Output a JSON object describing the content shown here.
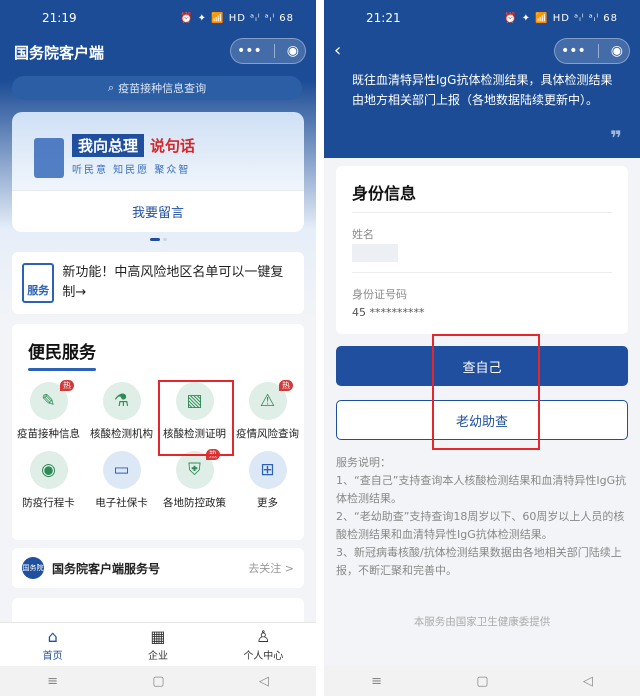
{
  "left": {
    "status": {
      "time": "21:19",
      "icons": "⏰ ✦ 📶 HD ᵃᵢˡ ᵃᵢˡ 68"
    },
    "app_title": "国务院客户端",
    "capsule": {
      "more": "•••",
      "close": "◉"
    },
    "search_placeholder": "疫苗接种信息查询",
    "banner": {
      "title_part1": "我向总理",
      "title_part2": "说句话",
      "subtitle": "听民意 知民愿 聚众智",
      "button": "我要留言"
    },
    "notice": {
      "icon_label": "服务",
      "text": "新功能！中高风险地区名单可以一键复制→"
    },
    "services": {
      "title": "便民服务",
      "items": [
        {
          "label": "疫苗接种信息",
          "icon": "clipboard-pen-icon",
          "glyph": "✎",
          "hot": "热"
        },
        {
          "label": "核酸检测机构",
          "icon": "test-tube-icon",
          "glyph": "⚗",
          "hot": ""
        },
        {
          "label": "核酸检测证明",
          "icon": "certificate-icon",
          "glyph": "▧",
          "hot": ""
        },
        {
          "label": "疫情风险查询",
          "icon": "warning-icon",
          "glyph": "⚠",
          "hot": "热"
        },
        {
          "label": "防疫行程卡",
          "icon": "location-pin-icon",
          "glyph": "◉",
          "hot": ""
        },
        {
          "label": "电子社保卡",
          "icon": "id-card-icon",
          "glyph": "▭",
          "hot": ""
        },
        {
          "label": "各地防控政策",
          "icon": "shield-doc-icon",
          "glyph": "⛨",
          "hot": "热"
        },
        {
          "label": "更多",
          "icon": "grid-more-icon",
          "glyph": "⊞",
          "hot": ""
        }
      ]
    },
    "account": {
      "logo": "国务院",
      "name": "国务院客户端服务号",
      "follow": "去关注 >"
    },
    "tabs": [
      {
        "label": "首页",
        "glyph": "⌂"
      },
      {
        "label": "企业",
        "glyph": "▦"
      },
      {
        "label": "个人中心",
        "glyph": "♙"
      }
    ],
    "nav": {
      "menu": "≡",
      "home": "▢",
      "back": "◁"
    }
  },
  "right": {
    "status": {
      "time": "21:21",
      "icons": "⏰ ✦ 📶 HD ᵃᵢˡ ᵃᵢˡ 68"
    },
    "capsule": {
      "more": "•••",
      "close": "◉"
    },
    "back": "‹",
    "quote_text": "既往血清特异性IgG抗体检测结果，具体检测结果由地方相关部门上报（各地数据陆续更新中）。",
    "quote_mark": "❞",
    "identity": {
      "title": "身份信息",
      "name_label": "姓名",
      "id_label": "身份证号码",
      "id_value": "45  **********"
    },
    "buttons": {
      "self": "查自己",
      "assist": "老幼助查"
    },
    "notes": [
      "服务说明：",
      "1、“查自己”支持查询本人核酸检测结果和血清特异性IgG抗体检测结果。",
      "2、“老幼助查”支持查询18周岁以下、60周岁以上人员的核酸检测结果和血清特异性IgG抗体检测结果。",
      "3、新冠病毒核酸/抗体检测结果数据由各地相关部门陆续上报，不断汇聚和完善中。"
    ],
    "footer": "本服务由国家卫生健康委提供",
    "nav": {
      "menu": "≡",
      "home": "▢",
      "back": "◁"
    }
  }
}
